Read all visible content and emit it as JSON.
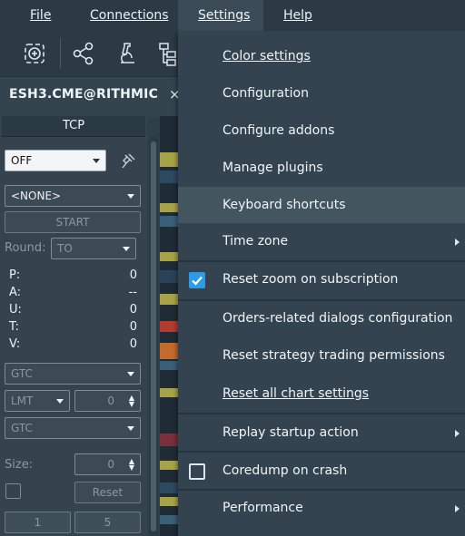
{
  "menubar": {
    "file": "File",
    "connections": "Connections",
    "settings": "Settings",
    "help": "Help"
  },
  "toolbar": {
    "icons": [
      "zoom-in-icon",
      "share-icon",
      "microscope-icon",
      "hierarchy-icon"
    ]
  },
  "instrument": {
    "title": "ESH3.CME@RITHMIC",
    "close": "×"
  },
  "panel": {
    "header": "TCP",
    "mode": "OFF",
    "strategy": "<NONE>",
    "start": "START",
    "round_label": "Round:",
    "round_value": "TO",
    "rows": [
      {
        "label": "P:",
        "value": "0"
      },
      {
        "label": "A:",
        "value": "--"
      },
      {
        "label": "U:",
        "value": "0"
      },
      {
        "label": "T:",
        "value": "0"
      },
      {
        "label": "V:",
        "value": "0"
      }
    ],
    "tif1": "GTC",
    "order_type": "LMT",
    "price": "0",
    "tif2": "GTC",
    "size_label": "Size:",
    "size_value": "0",
    "reset": "Reset",
    "qty1": "1",
    "qty2": "5"
  },
  "settings_menu": {
    "color_settings": "Color settings",
    "configuration": "Configuration",
    "configure_addons": "Configure addons",
    "manage_plugins": "Manage plugins",
    "keyboard_shortcuts": "Keyboard shortcuts",
    "time_zone": "Time zone",
    "reset_zoom": "Reset zoom on subscription",
    "reset_zoom_checked": true,
    "orders_dialogs": "Orders-related dialogs configuration",
    "reset_strategy": "Reset strategy trading permissions",
    "reset_chart": "Reset all chart settings",
    "replay_startup": "Replay startup action",
    "coredump": "Coredump on crash",
    "coredump_checked": false,
    "performance": "Performance"
  },
  "colors": {
    "accent": "#2d9ce8",
    "menu_bg": "#33434f",
    "highlight": "#43555f"
  }
}
